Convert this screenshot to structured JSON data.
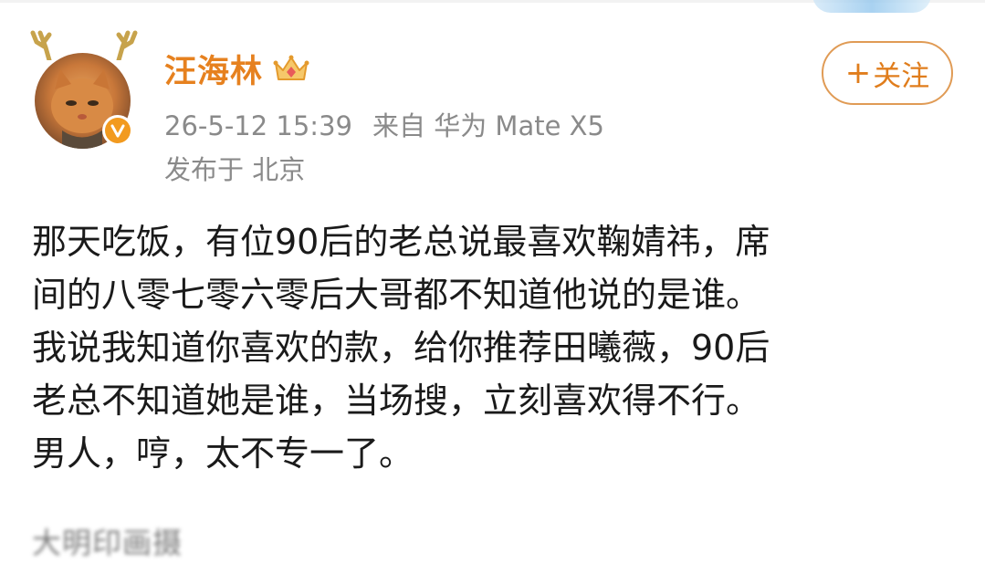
{
  "post": {
    "author": {
      "name": "汪海林",
      "avatar_icon": "cat-avatar",
      "badge_icon": "verified-v-icon",
      "vip_icon": "crown-icon"
    },
    "meta": {
      "timestamp": "26-5-12 15:39",
      "source": "来自 华为 Mate X5",
      "location": "发布于 北京"
    },
    "follow_button": {
      "plus": "+",
      "label": "关注"
    },
    "content_lines": [
      "那天吃饭，有位90后的老总说最喜欢鞠婧祎，席",
      "间的八零七零六零后大哥都不知道他说的是谁。",
      "我说我知道你喜欢的款，给你推荐田曦薇，90后",
      "老总不知道她是谁，当场搜，立刻喜欢得不行。",
      "男人，哼，太不专一了。"
    ],
    "blurred_text": "大明印画摄"
  },
  "colors": {
    "username": "#e6811f",
    "follow_border": "#e09b55",
    "meta_text": "#8a8a8a",
    "body_text": "#1a1a1a",
    "verified_badge": "#f29a1f"
  }
}
